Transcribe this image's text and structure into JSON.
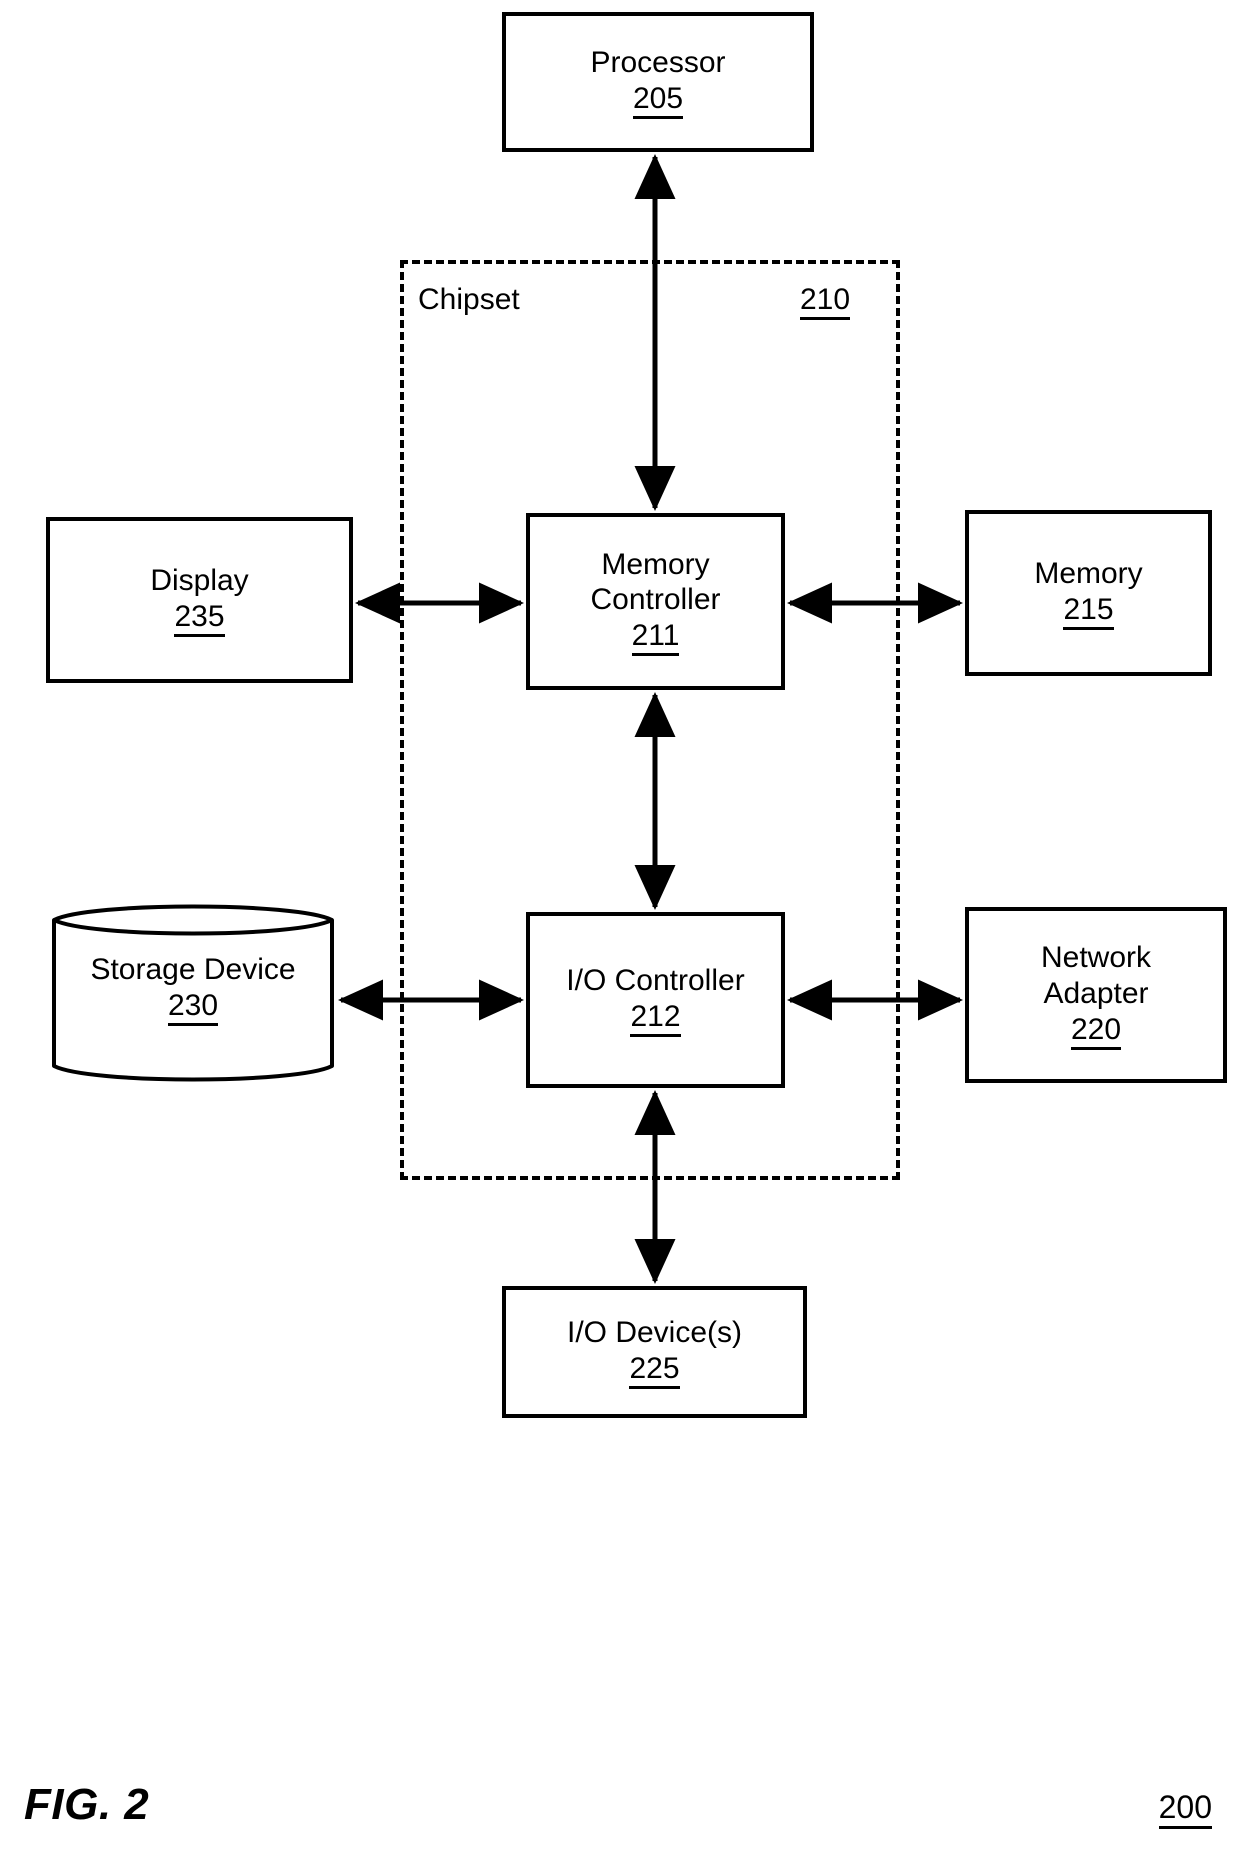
{
  "figure": {
    "caption": "FIG. 2",
    "reference_numeral": "200"
  },
  "chipset": {
    "title": "Chipset",
    "reference_numeral": "210"
  },
  "nodes": {
    "processor": {
      "label": "Processor",
      "ref": "205"
    },
    "memory_controller": {
      "label": "Memory\nController",
      "ref": "211"
    },
    "io_controller": {
      "label": "I/O Controller",
      "ref": "212"
    },
    "display": {
      "label": "Display",
      "ref": "235"
    },
    "memory": {
      "label": "Memory",
      "ref": "215"
    },
    "storage": {
      "label": "Storage Device",
      "ref": "230"
    },
    "network_adapter": {
      "label": "Network\nAdapter",
      "ref": "220"
    },
    "io_devices": {
      "label": "I/O Device(s)",
      "ref": "225"
    }
  },
  "connections": [
    {
      "from": "processor",
      "to": "memory_controller",
      "style": "double-arrow",
      "orientation": "vertical"
    },
    {
      "from": "display",
      "to": "memory_controller",
      "style": "double-arrow",
      "orientation": "horizontal"
    },
    {
      "from": "memory_controller",
      "to": "memory",
      "style": "double-arrow",
      "orientation": "horizontal"
    },
    {
      "from": "memory_controller",
      "to": "io_controller",
      "style": "double-arrow",
      "orientation": "vertical"
    },
    {
      "from": "storage",
      "to": "io_controller",
      "style": "double-arrow",
      "orientation": "horizontal"
    },
    {
      "from": "io_controller",
      "to": "network_adapter",
      "style": "double-arrow",
      "orientation": "horizontal"
    },
    {
      "from": "io_controller",
      "to": "io_devices",
      "style": "double-arrow",
      "orientation": "vertical"
    }
  ],
  "colors": {
    "stroke": "#000000",
    "background": "#ffffff"
  }
}
